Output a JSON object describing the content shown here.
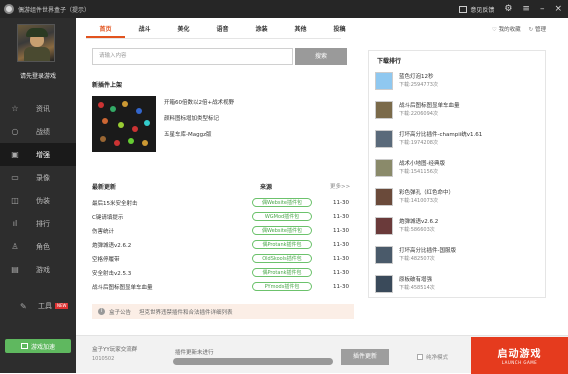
{
  "window": {
    "title": "偶游组件世界盒子（提示）",
    "feedback": "意见反馈",
    "settings_icon": "gear-icon",
    "menu_icon": "menu-icon",
    "minimize": "–",
    "close": "×"
  },
  "sidebar": {
    "login": "请先登录游戏",
    "items": [
      {
        "label": "资讯",
        "icon": "star-icon",
        "glyph": "☆"
      },
      {
        "label": "战绩",
        "icon": "search-icon",
        "glyph": "○"
      },
      {
        "label": "增强",
        "icon": "briefcase-icon",
        "glyph": "▣"
      },
      {
        "label": "录像",
        "icon": "video-icon",
        "glyph": "▭"
      },
      {
        "label": "伪装",
        "icon": "mask-icon",
        "glyph": "◫"
      },
      {
        "label": "排行",
        "icon": "ranking-icon",
        "glyph": "ıl"
      },
      {
        "label": "角色",
        "icon": "user-icon",
        "glyph": "♙"
      },
      {
        "label": "游戏",
        "icon": "gamepad-icon",
        "glyph": "▤"
      }
    ],
    "active_index": 2,
    "tools": {
      "label": "工具",
      "badge": "NEW"
    },
    "speed_button": "游戏加速"
  },
  "tabs": {
    "items": [
      "首页",
      "战斗",
      "美化",
      "语音",
      "涂装",
      "其他",
      "投稿"
    ],
    "active_index": 0
  },
  "top_links": {
    "favorites": "我的收藏",
    "manage": "管理"
  },
  "search": {
    "placeholder": "请输入内容",
    "button": "搜索"
  },
  "featured": {
    "title": "新插件上架",
    "items": [
      "开箱60倍数以2倍+战术视野",
      "颜料图标增加类型标记",
      "五星车库-Maggz版"
    ]
  },
  "updates": {
    "title": "最新更新",
    "source_header": "来源",
    "more": "更多>>",
    "rows": [
      {
        "name": "最后15米安全射击",
        "source": "偶Website插件包",
        "date": "11-30"
      },
      {
        "name": "C键请填提示",
        "source": "WGMod插件包",
        "date": "11-30"
      },
      {
        "name": "伤害统计",
        "source": "偶Website插件包",
        "date": "11-30"
      },
      {
        "name": "炮弹城语v2.6.2",
        "source": "偶Protank插件包",
        "date": "11-30"
      },
      {
        "name": "空格停履带",
        "source": "OldSkools插件包",
        "date": "11-30"
      },
      {
        "name": "安全射击v2.5.3",
        "source": "偶Protank插件包",
        "date": "11-30"
      },
      {
        "name": "战斗后图标图显单车血量",
        "source": "PYmods插件包",
        "date": "11-30"
      }
    ]
  },
  "notice": {
    "label": "盒子公告",
    "text": "坦克世界违禁插件和合法插件详细列表"
  },
  "downloads": {
    "title": "下载排行",
    "prefix": "下载:",
    "items": [
      {
        "name": "蓝色灯泡12秒",
        "count": "2594773次",
        "color": "#8fc8f0"
      },
      {
        "name": "战斗后图标图显单车血量",
        "count": "2206094次",
        "color": "#7a6a4a"
      },
      {
        "name": "打坏高分比插件-champii统v1.61",
        "count": "1974208次",
        "color": "#5a6a7a"
      },
      {
        "name": "战术小地图-经典版",
        "count": "1541156次",
        "color": "#8a8a6a"
      },
      {
        "name": "彩色弹孔（红色命中）",
        "count": "1410073次",
        "color": "#6a4a3a"
      },
      {
        "name": "炮弹城语v2.6.2",
        "count": "586603次",
        "color": "#6a3a3a"
      },
      {
        "name": "打坏高分比插件-国服版",
        "count": "482507次",
        "color": "#4a5a6a"
      },
      {
        "name": "原板破有增强",
        "count": "458514次",
        "color": "#3a4a5a"
      }
    ]
  },
  "bottom": {
    "box_label": "盒子YY玩家交流群",
    "box_id": "1010502",
    "progress_label": "插件更新未进行",
    "progress": 0,
    "update_button": "插件更新",
    "pure_mode": "纯净模式",
    "launch": "启动游戏",
    "launch_en": "LAUNCH GAME"
  }
}
